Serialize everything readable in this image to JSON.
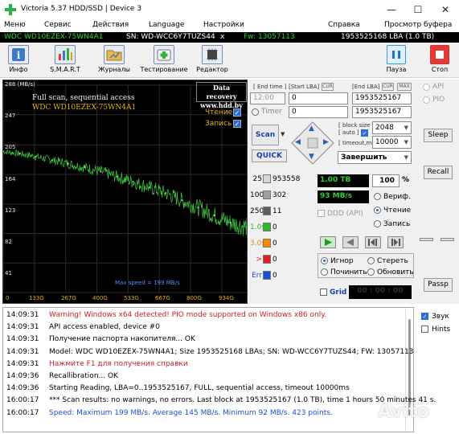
{
  "window": {
    "title": "Victoria 5.37 HDD/SSD | Device 3",
    "controls": {
      "minimize": "—",
      "maximize": "☐",
      "close": "✕"
    }
  },
  "menu": {
    "items": [
      "Меню",
      "Сервис",
      "Действия",
      "Language",
      "Настройки",
      "Справка",
      "Просмотр буфера"
    ]
  },
  "device_bar": {
    "model": "WDC WD10EZEX-75WN4A1",
    "serial": "SN: WD-WCC6Y7TUZS44",
    "close": "x",
    "firmware": "Fw: 13057113",
    "capacity": "1953525168 LBA (1.0 TB)"
  },
  "toolbar": {
    "buttons": [
      "Инфо",
      "S.M.A.R.T",
      "Журналы",
      "Тестирование",
      "Редактор"
    ],
    "pause": "Пауза",
    "stop": "Стоп"
  },
  "graph": {
    "y_labels": [
      "288 (MB/s)",
      "247",
      "205",
      "164",
      "123",
      "82",
      "41"
    ],
    "x_labels": [
      "0",
      "133G",
      "267G",
      "400G",
      "533G",
      "667G",
      "800G",
      "934G"
    ],
    "title": "Full scan, sequential access",
    "model": "WDC WD10EZEX-75WN4A1",
    "badge_line1": "Data recovery",
    "badge_line2": "www.hdd.by",
    "read_label": "Чтение",
    "write_label": "Запись",
    "speed_note": "Max speed = 199 MB/s"
  },
  "chart_data": {
    "type": "line",
    "title": "Full scan, sequential access",
    "ylabel": "(MB/s)",
    "xlabel": "",
    "ylim": [
      0,
      288
    ],
    "y_ticks": [
      0,
      41,
      82,
      123,
      164,
      205,
      247,
      288
    ],
    "x_ticks": [
      "0",
      "133G",
      "267G",
      "400G",
      "533G",
      "667G",
      "800G",
      "934G"
    ],
    "series": [
      {
        "x": [
          0,
          67,
          133,
          200,
          267,
          333,
          400,
          467,
          533,
          600,
          667,
          733,
          800,
          867,
          934,
          1000
        ],
        "values": [
          196,
          193,
          189,
          184,
          179,
          174,
          168,
          161,
          154,
          146,
          138,
          128,
          118,
          107,
          97,
          91
        ],
        "color": "#3ec83e"
      }
    ]
  },
  "controls": {
    "end_time_label": "[ End time ]",
    "start_lba_label": "[Start LBA]",
    "cur_tag": "CUR",
    "end_lba_label": "[End LBA]",
    "max_tag": "MAX",
    "time_value": "12:00",
    "start_lba": "0",
    "end_lba": "1953525167",
    "timer_label": "Timer",
    "timer_value": "0",
    "end_lba_cur": "1953525167",
    "scan_label": "Scan",
    "quick_label": "QUICK",
    "block_size_label": "[ block size ]",
    "auto_label": "[ auto ]",
    "timeout_label": "[ timeout,ms ]",
    "block_size": "2048",
    "timeout": "10000",
    "finish_option": "Завершить",
    "nav_arrows": [
      "▲",
      "▼",
      "◀",
      "▶"
    ],
    "capacity_display": "1.00 TB",
    "progress_display": "100",
    "percent_sign": "%",
    "speed_display": "93 MB/s",
    "ddd_label": "DDD (API)",
    "verify_label": "Вериф.",
    "read_label": "Чтение",
    "write_label": "Запись",
    "ignore_label": "Игнор",
    "erase_label": "Стереть",
    "repair_label": "Починить",
    "refresh_label": "Обновить",
    "grid_label": "Grid",
    "grid_time": "00 : 00 : 00",
    "stats": [
      {
        "label": "25",
        "value": "953558",
        "color": "#d6d6d6"
      },
      {
        "label": "100",
        "value": "302",
        "color": "#9e9e9e"
      },
      {
        "label": "250",
        "value": "11",
        "color": "#5f5f5f"
      },
      {
        "label": "1.0s",
        "value": "0",
        "color": "#2fb52f"
      },
      {
        "label": "3.0s",
        "value": "0",
        "color": "#f08a00"
      },
      {
        "label": ">",
        "value": "0",
        "color": "#e02020"
      },
      {
        "label": "Err",
        "value": "0",
        "color": "#1a4fd8"
      }
    ]
  },
  "right_panel": {
    "api_label": "API",
    "pio_label": "PIO",
    "sleep": "Sleep",
    "recall": "Recall",
    "passp": "Passp",
    "sound_label": "Звук",
    "hints_label": "Hints"
  },
  "log": [
    {
      "time": "14:09:31",
      "msg": "Warning! Windows x64 detected! PIO mode supported on Windows x86 only.",
      "color": "#d02020"
    },
    {
      "time": "14:09:31",
      "msg": "API access enabled, device #0",
      "color": "#000000"
    },
    {
      "time": "14:09:31",
      "msg": "Получение паспорта накопителя... OK",
      "color": "#000000"
    },
    {
      "time": "14:09:31",
      "msg": "Model: WDC WD10EZEX-75WN4A1; Size 1953525168 LBAs; SN: WD-WCC6Y7TUZS44; FW: 13057113",
      "color": "#000000"
    },
    {
      "time": "14:09:31",
      "msg": "Нажмите F1 для получения справки",
      "color": "#d02020"
    },
    {
      "time": "14:09:36",
      "msg": "Recallibration... OK",
      "color": "#000000"
    },
    {
      "time": "14:09:36",
      "msg": "Starting Reading, LBA=0..1953525167, FULL, sequential access, timeout 10000ms",
      "color": "#000000"
    },
    {
      "time": "16:00:17",
      "msg": "*** Scan results: no warnings, no errors. Last block at 1953525167 (1.0 TB), time 1 hours 50 minutes 41 s.",
      "color": "#000000"
    },
    {
      "time": "16:00:17",
      "msg": "Speed: Maximum 199 MB/s. Average 145 MB/s. Minimum 92 MB/s. 423 points.",
      "color": "#1a4fd8"
    }
  ],
  "watermark": "Avito"
}
